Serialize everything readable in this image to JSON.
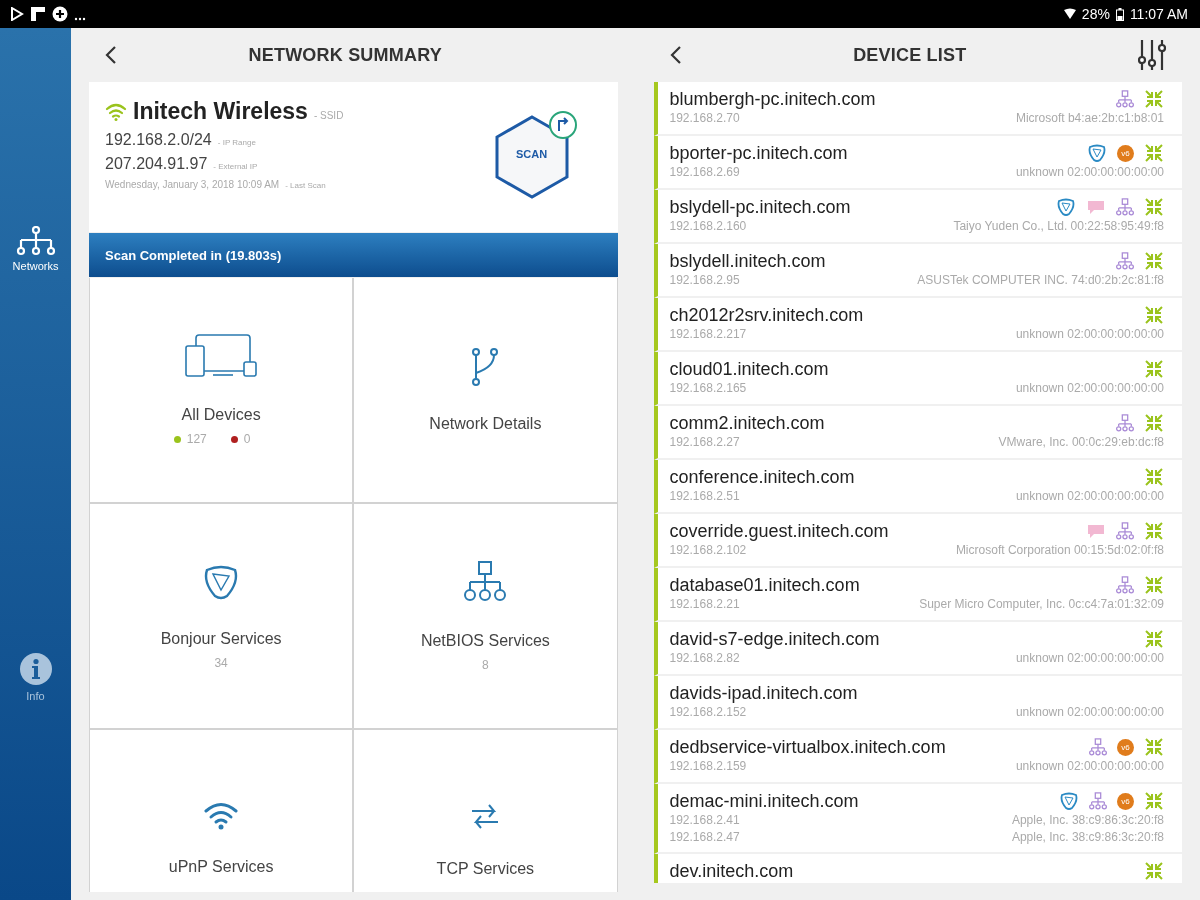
{
  "status_bar": {
    "left_icons": [
      {
        "kind": "play"
      },
      {
        "kind": "flipboard"
      },
      {
        "kind": "plus"
      },
      {
        "kind": "more"
      }
    ],
    "battery_text": "28%",
    "time": "11:07 AM"
  },
  "sidebar": {
    "items": [
      {
        "kind": "networks",
        "label": "Networks",
        "selected": true
      },
      {
        "kind": "info",
        "label": "Info",
        "selected": false
      }
    ]
  },
  "network_summary": {
    "title": "NETWORK SUMMARY",
    "card": {
      "ssid": "Initech Wireless",
      "ssid_label": "- SSID",
      "ip_range": "192.168.2.0/24",
      "ip_range_label": "- IP Range",
      "external_ip": "207.204.91.97",
      "external_ip_label": "- External IP",
      "last_scan": "Wednesday, January 3, 2018 10:09 AM",
      "last_scan_label": "- Last Scan",
      "scan_button": "SCAN"
    },
    "banner": "Scan Completed in (19.803s)",
    "tiles": [
      {
        "kind": "devices",
        "label": "All Devices",
        "stats": [
          {
            "value": "127",
            "color": "#9ac31c"
          },
          {
            "value": "0",
            "color": "#b02020"
          }
        ]
      },
      {
        "kind": "branch",
        "label": "Network Details"
      },
      {
        "kind": "bonjour",
        "label": "Bonjour Services",
        "count": "34"
      },
      {
        "kind": "netbios",
        "label": "NetBIOS Services",
        "count": "8"
      },
      {
        "kind": "wifi",
        "label": "uPnP Services"
      },
      {
        "kind": "arrows",
        "label": "TCP Services"
      }
    ]
  },
  "device_list": {
    "title": "DEVICE LIST",
    "devices": [
      {
        "name": "blumbergh-pc.initech.com",
        "addresses": [
          {
            "ip": "192.168.2.70",
            "vendor": "Microsoft b4:ae:2b:c1:b8:01"
          }
        ],
        "icons": [
          {
            "kind": "netbios"
          },
          {
            "kind": "online"
          }
        ]
      },
      {
        "name": "bporter-pc.initech.com",
        "addresses": [
          {
            "ip": "192.168.2.69",
            "vendor": "unknown 02:00:00:00:00:00"
          }
        ],
        "icons": [
          {
            "kind": "bonjour"
          },
          {
            "kind": "ipv6",
            "label": "v6"
          },
          {
            "kind": "online"
          }
        ]
      },
      {
        "name": "bslydell-pc.initech.com",
        "addresses": [
          {
            "ip": "192.168.2.160",
            "vendor": "Taiyo Yuden Co., Ltd. 00:22:58:95:49:f8"
          }
        ],
        "icons": [
          {
            "kind": "bonjour"
          },
          {
            "kind": "chat"
          },
          {
            "kind": "netbios"
          },
          {
            "kind": "online"
          }
        ]
      },
      {
        "name": "bslydell.initech.com",
        "addresses": [
          {
            "ip": "192.168.2.95",
            "vendor": "ASUSTek COMPUTER INC. 74:d0:2b:2c:81:f8"
          }
        ],
        "icons": [
          {
            "kind": "netbios"
          },
          {
            "kind": "online"
          }
        ]
      },
      {
        "name": "ch2012r2srv.initech.com",
        "addresses": [
          {
            "ip": "192.168.2.217",
            "vendor": "unknown 02:00:00:00:00:00"
          }
        ],
        "icons": [
          {
            "kind": "online"
          }
        ]
      },
      {
        "name": "cloud01.initech.com",
        "addresses": [
          {
            "ip": "192.168.2.165",
            "vendor": "unknown 02:00:00:00:00:00"
          }
        ],
        "icons": [
          {
            "kind": "online"
          }
        ]
      },
      {
        "name": "comm2.initech.com",
        "addresses": [
          {
            "ip": "192.168.2.27",
            "vendor": "VMware, Inc. 00:0c:29:eb:dc:f8"
          }
        ],
        "icons": [
          {
            "kind": "netbios"
          },
          {
            "kind": "online"
          }
        ]
      },
      {
        "name": "conference.initech.com",
        "addresses": [
          {
            "ip": "192.168.2.51",
            "vendor": "unknown 02:00:00:00:00:00"
          }
        ],
        "icons": [
          {
            "kind": "online"
          }
        ]
      },
      {
        "name": "coverride.guest.initech.com",
        "addresses": [
          {
            "ip": "192.168.2.102",
            "vendor": "Microsoft Corporation 00:15:5d:02:0f:f8"
          }
        ],
        "icons": [
          {
            "kind": "chat"
          },
          {
            "kind": "netbios"
          },
          {
            "kind": "online"
          }
        ]
      },
      {
        "name": "database01.initech.com",
        "addresses": [
          {
            "ip": "192.168.2.21",
            "vendor": "Super Micro Computer, Inc. 0c:c4:7a:01:32:09"
          }
        ],
        "icons": [
          {
            "kind": "netbios"
          },
          {
            "kind": "online"
          }
        ]
      },
      {
        "name": "david-s7-edge.initech.com",
        "addresses": [
          {
            "ip": "192.168.2.82",
            "vendor": "unknown 02:00:00:00:00:00"
          }
        ],
        "icons": [
          {
            "kind": "online"
          }
        ]
      },
      {
        "name": "davids-ipad.initech.com",
        "addresses": [
          {
            "ip": "192.168.2.152",
            "vendor": "unknown 02:00:00:00:00:00"
          }
        ]
      },
      {
        "name": "dedbservice-virtualbox.initech.com",
        "addresses": [
          {
            "ip": "192.168.2.159",
            "vendor": "unknown 02:00:00:00:00:00"
          }
        ],
        "icons": [
          {
            "kind": "netbios"
          },
          {
            "kind": "ipv6",
            "label": "v6"
          },
          {
            "kind": "online"
          }
        ]
      },
      {
        "name": "demac-mini.initech.com",
        "addresses": [
          {
            "ip": "192.168.2.41",
            "vendor": "Apple, Inc. 38:c9:86:3c:20:f8"
          },
          {
            "ip": "192.168.2.47",
            "vendor": "Apple, Inc. 38:c9:86:3c:20:f8"
          }
        ],
        "icons": [
          {
            "kind": "bonjour"
          },
          {
            "kind": "netbios"
          },
          {
            "kind": "ipv6",
            "label": "v6"
          },
          {
            "kind": "online"
          }
        ]
      },
      {
        "name": "dev.initech.com",
        "icons": [
          {
            "kind": "online"
          }
        ]
      }
    ]
  }
}
